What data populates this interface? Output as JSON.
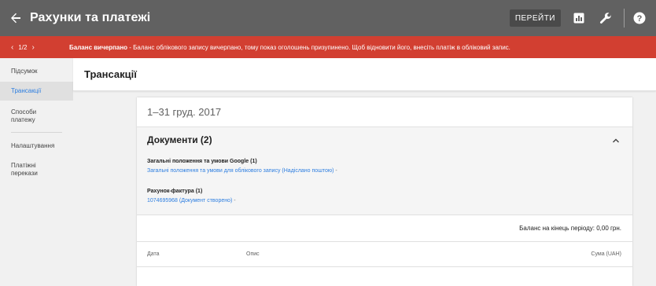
{
  "topbar": {
    "title": "Рахунки та платежі",
    "goto_label": "ПЕРЕЙТИ",
    "icons": [
      "back-arrow-icon",
      "reports-icon",
      "wrench-icon",
      "help-icon"
    ]
  },
  "alert": {
    "pager": "1/2",
    "bold": "Баланс вичерпано",
    "text": " - Баланс облікового запису вичерпано, тому показ оголошень призупинено. Щоб відновити його, внесіть платіж в обліковий запис.",
    "color": "#d23f31"
  },
  "sidebar": {
    "items": [
      {
        "label": "Підсумок"
      },
      {
        "label": "Трансакції"
      },
      {
        "label": "Способи платежу"
      },
      {
        "label": "Налаштування"
      },
      {
        "label": "Платіжні перекази"
      }
    ]
  },
  "main": {
    "title": "Трансакції",
    "period": "1–31 груд. 2017",
    "documents": {
      "title": "Документи (2)",
      "groups": [
        {
          "title": "Загальні положення та умови Google (1)",
          "link": "Загальні положення та умови для облікового запису (Надіслано поштою)",
          "dash": "-"
        },
        {
          "title": "Рахунок-фактура (1)",
          "link": "1074695968 (Документ створено)",
          "dash": "-"
        }
      ]
    },
    "balance": "Баланс на кінець періоду: 0,00 грн.",
    "table": {
      "columns": [
        "Дата",
        "Опис",
        "Сума (UAH)"
      ]
    }
  },
  "colors": {
    "accent": "#2d7ee0",
    "topbar": "#616161"
  }
}
